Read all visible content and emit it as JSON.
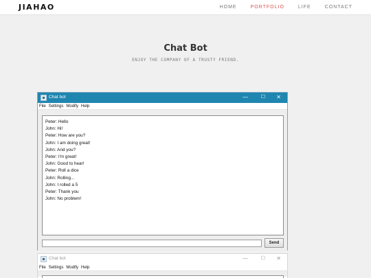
{
  "nav": {
    "brand": "JIAHAO",
    "links": [
      "HOME",
      "PORTFOLIO",
      "LIFE",
      "CONTACT"
    ],
    "active_link": "PORTFOLIO",
    "active_color": "#d9534f"
  },
  "hero": {
    "title": "Chat Bot",
    "subtitle": "ENJOY THE COMPANY OF A TRUSTY FRIEND."
  },
  "window": {
    "title": "Chat bot",
    "menus": [
      "File",
      "Settings",
      "Modify",
      "Help"
    ],
    "title_bar_color": "#1f86b0",
    "controls": {
      "minimize": "—",
      "maximize": "☐",
      "close": "✕"
    },
    "messages": [
      "Peter: Hello",
      "John: Hi!",
      "Peter: How are you?",
      "John: I am doing great!",
      "John: And you?",
      "Peter: I'm great!",
      "John: Good to hear!",
      "Peter: Roll a dice",
      "John: Rolling...",
      "John: I rolled a 5",
      "Peter: Thank you",
      "John: No problem!"
    ],
    "input_value": "",
    "send_label": "Send"
  },
  "window2": {
    "title": "Chat bot",
    "menus": [
      "File",
      "Settings",
      "Modify",
      "Help"
    ],
    "controls": {
      "minimize": "—",
      "maximize": "☐",
      "close": "✕"
    }
  }
}
